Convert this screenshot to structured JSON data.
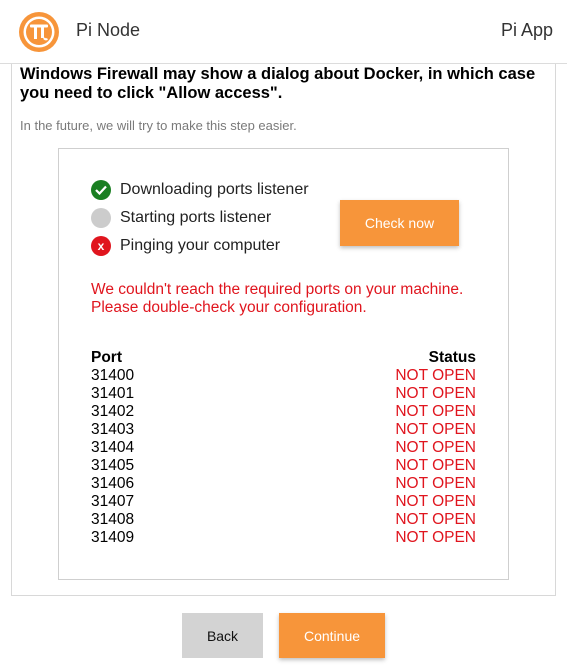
{
  "header": {
    "app_name": "Pi Node",
    "right_link": "Pi App",
    "logo_icon": "pi-logo-icon",
    "brand_color": "#f7953a"
  },
  "main": {
    "title": "Windows Firewall may show a dialog about Docker, in which case you need to click \"Allow access\".",
    "subtitle": "In the future, we will try to make this step easier."
  },
  "steps": [
    {
      "label": "Downloading ports listener",
      "state": "done",
      "icon": "check-icon"
    },
    {
      "label": "Starting ports listener",
      "state": "pending",
      "icon": "pending-circle-icon"
    },
    {
      "label": "Pinging your computer",
      "state": "failed",
      "icon": "x-icon",
      "icon_text": "x"
    }
  ],
  "check_button": "Check now",
  "error": {
    "line1": "We couldn't reach the required ports on your machine.",
    "line2": "Please double-check your configuration."
  },
  "table": {
    "headers": {
      "port": "Port",
      "status": "Status"
    },
    "rows": [
      {
        "port": "31400",
        "status": "NOT OPEN"
      },
      {
        "port": "31401",
        "status": "NOT OPEN"
      },
      {
        "port": "31402",
        "status": "NOT OPEN"
      },
      {
        "port": "31403",
        "status": "NOT OPEN"
      },
      {
        "port": "31404",
        "status": "NOT OPEN"
      },
      {
        "port": "31405",
        "status": "NOT OPEN"
      },
      {
        "port": "31406",
        "status": "NOT OPEN"
      },
      {
        "port": "31407",
        "status": "NOT OPEN"
      },
      {
        "port": "31408",
        "status": "NOT OPEN"
      },
      {
        "port": "31409",
        "status": "NOT OPEN"
      }
    ]
  },
  "footer": {
    "back_label": "Back",
    "continue_label": "Continue"
  },
  "colors": {
    "accent": "#f7953a",
    "error": "#e0151e",
    "success": "#1a7f22",
    "pending": "#cccccc"
  }
}
